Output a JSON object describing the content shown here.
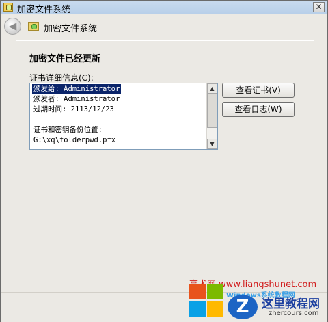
{
  "window": {
    "title": "加密文件系统",
    "close_label": "✕"
  },
  "nav": {
    "back_glyph": "◀",
    "title": "加密文件系统"
  },
  "main": {
    "heading": "加密文件已经更新",
    "details_label": "证书详细信息(C):",
    "details_lines": [
      "颁发给: Administrator",
      "颁发者: Administrator",
      "过期时间: 2113/12/23",
      "",
      "证书和密钥备份位置:",
      "G:\\xq\\folderpwd.pfx"
    ],
    "buttons": {
      "view_cert": "查看证书(V)",
      "view_log": "查看日志(W)"
    }
  },
  "scrollbar": {
    "up_glyph": "▲",
    "down_glyph": "▼"
  },
  "watermark": {
    "line1": "亮术网 www.liangshunet.com",
    "line2": "Windows系统教程网",
    "badge": "Z",
    "site_name": "这里教程网",
    "site_url": "zhercours.com"
  },
  "colors": {
    "selection": "#0a246a",
    "window_bg": "#ebe9e4",
    "titlebar": "#c9dbef"
  }
}
